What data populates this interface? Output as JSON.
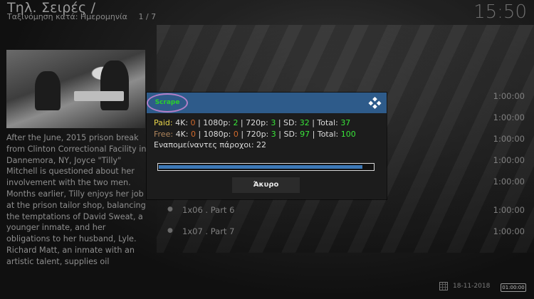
{
  "header": {
    "title": "Τηλ. Σειρές /",
    "sort_label": "Ταξινόμηση κατά: Ημερομηνία",
    "page_counter": "1 / 7",
    "clock": "15:50"
  },
  "sidebar": {
    "plot": "After the June, 2015 prison break from Clinton Correctional Facility in Dannemora, NY, Joyce \"Tilly\" Mitchell is questioned about her involvement with the two men. Months earlier, Tilly enjoys her job at the prison tailor shop, balancing the temptations of David Sweat, a younger inmate, and her obligations to her husband, Lyle. Richard Matt, an inmate with an artistic talent, supplies oil"
  },
  "episodes": [
    {
      "title": "",
      "duration": "1:00:00"
    },
    {
      "title": "",
      "duration": "1:00:00"
    },
    {
      "title": "",
      "duration": "1:00:00"
    },
    {
      "title": "",
      "duration": "1:00:00"
    },
    {
      "title": "",
      "duration": "1:00:00"
    },
    {
      "title": "1x06 . Part 6",
      "duration": "1:00:00"
    },
    {
      "title": "1x07 . Part 7",
      "duration": "1:00:00"
    }
  ],
  "footer": {
    "date": "18-11-2018",
    "time": "01:00:00"
  },
  "dialog": {
    "heading": "Scrape",
    "paid": {
      "label": "Paid:",
      "k4_label": "4K:",
      "k4": "0",
      "p1080_label": "1080p:",
      "p1080": "2",
      "p720_label": "720p:",
      "p720": "3",
      "sd_label": "SD:",
      "sd": "32",
      "total_label": "Total:",
      "total": "37"
    },
    "free": {
      "label": "Free:",
      "k4_label": "4K:",
      "k4": "0",
      "p1080_label": "1080p:",
      "p1080": "0",
      "p720_label": "720p:",
      "p720": "3",
      "sd_label": "SD:",
      "sd": "97",
      "total_label": "Total:",
      "total": "100"
    },
    "remaining": "Εναπομείναντες πάροχοι: 22",
    "progress": 0.95,
    "cancel_label": "Άκυρο"
  },
  "colors": {
    "header_bar": "#2e5b8a",
    "paid_label": "#e8d44a",
    "free_label": "#b0865c",
    "positive_value": "#39e639",
    "zero_value": "#d06a2c",
    "progress_fill": "#3c78b6",
    "annotation_circle": "#b27fc6"
  },
  "icons": {
    "kodi_logo": "kodi-icon",
    "calendar": "calendar-icon"
  }
}
